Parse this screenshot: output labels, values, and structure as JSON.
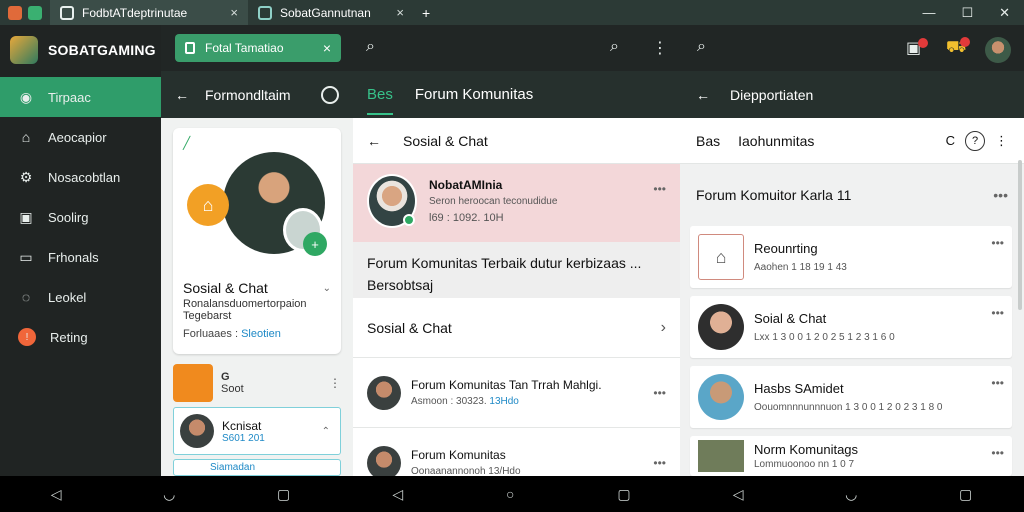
{
  "titlebar": {
    "tabs": [
      {
        "label": "FodbtATdeptrinutae",
        "close": "×"
      },
      {
        "label": "SobatGannutnan",
        "close": "×"
      }
    ],
    "new_tab": "+",
    "controls": [
      "—",
      "☐",
      "✕"
    ]
  },
  "app": {
    "name": "SOBATGAMING"
  },
  "pill": {
    "label": "Fotal Tamatiao",
    "close": "×"
  },
  "sidebar": {
    "items": [
      {
        "label": "Tirpaac",
        "icon": "home-icon"
      },
      {
        "label": "Aeocapior",
        "icon": "house-icon"
      },
      {
        "label": "Nosacobtlan",
        "icon": "gear-icon"
      },
      {
        "label": "Soolirg",
        "icon": "image-icon"
      },
      {
        "label": "Frhonals",
        "icon": "chat-icon"
      },
      {
        "label": "Leokel",
        "icon": "globe-icon"
      },
      {
        "label": "Reting",
        "icon": "alert-icon"
      }
    ]
  },
  "col1": {
    "back": "←",
    "title": "Formondltaim",
    "card": {
      "title": "Sosial & Chat",
      "sub": "Ronalansduomertorpaion Tegebarst",
      "foot_label": "Forluaaes :",
      "foot_link": "Sleotien"
    },
    "mini_text": "G",
    "mini_sub": "Soot",
    "friend": {
      "name": "Kcnisat",
      "sub": "S601 201"
    },
    "friend2": {
      "name": "Siamadan"
    }
  },
  "col2": {
    "tab_active": "Bes",
    "tab_title": "Forum Komunitas",
    "head": "Sosial & Chat",
    "feature": {
      "name": "NobatAMInia",
      "sub": "Seron heroocan teconudidue",
      "meta": "l69 : 1092. 10H"
    },
    "post": "Forum Komunitas Terbaik dutur kerbizaas ... Bersobtsaj",
    "row": "Sosial & Chat",
    "threads": [
      {
        "title": "Forum Komunitas Tan Trrah Mahlgi.",
        "meta": "Asmoon : 30323.",
        "link": "13Hdo"
      },
      {
        "title": "Forum Komunitas",
        "meta": "Oonaanannonoh 13/Hdo"
      }
    ]
  },
  "col3": {
    "back": "←",
    "title": "Diepportiaten",
    "sub_left": "Bas",
    "sub_title": "Iaohunmitas",
    "section": "Forum Komuitor Karla 11",
    "cards": [
      {
        "title": "Reounrting",
        "sub": "Aaohen 1 18 19 1 43"
      },
      {
        "title": "Soial & Chat",
        "sub": "Lxx 1 3 0 0 1 2 0 2 5 1 2 3 1 6 0"
      },
      {
        "title": "Hasbs SAmidet",
        "sub": "Oouomnnnunnnuon 1 3 0 0 1 2 0 2 3 1 8 0"
      },
      {
        "title": "Norm Komunitags",
        "sub": "Lommuoonoo nn 1 0 7"
      }
    ]
  },
  "colors": {
    "accent": "#2f9d6a",
    "header": "#26302d",
    "feature_bg": "#f3d7d9"
  }
}
